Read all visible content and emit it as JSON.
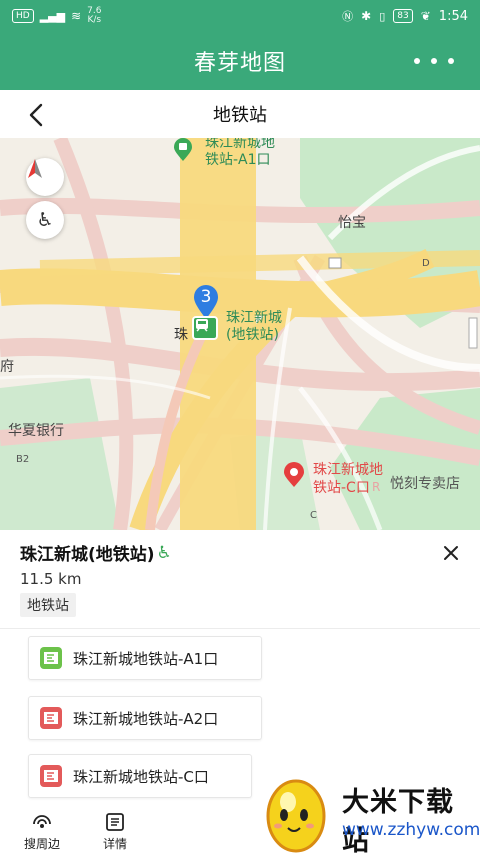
{
  "status_bar": {
    "left_icons": [
      "HD",
      "4G"
    ],
    "speed_value": "7.6",
    "speed_unit": "K/s",
    "battery": "83",
    "time": "1:54"
  },
  "app_bar": {
    "title": "春芽地图"
  },
  "nav_bar": {
    "title": "地铁站"
  },
  "map": {
    "poi_top": [
      "珠江新城地",
      "铁站-A1口"
    ],
    "poi_center": [
      "珠江新城",
      "(地铁站)"
    ],
    "poi_center_prefix": "珠",
    "poi_center_pin_number": "3",
    "label_yibao": "怡宝",
    "label_fu": "府",
    "label_huaxia": "华夏银行",
    "label_b2": "B2",
    "label_d": "D",
    "label_c": "C",
    "poi_bottom": [
      "珠江新城地",
      "铁站-C口"
    ],
    "poi_bottom_extra": "悦刻专卖店",
    "poi_bottom_faded": "R",
    "colors": {
      "road": "#f8d97e",
      "road_minor": "#f0c4c0",
      "park": "#c9e9c9",
      "water_green": "#b7e1c0"
    }
  },
  "place": {
    "name": "珠江新城(地铁站)",
    "distance": "11.5 km",
    "tag": "地铁站",
    "exits": [
      {
        "label": "珠江新城地铁站-A1口",
        "color": "#6cc24a"
      },
      {
        "label": "珠江新城地铁站-A2口",
        "color": "#e35a5a"
      },
      {
        "label": "珠江新城地铁站-C口",
        "color": "#e35a5a"
      }
    ]
  },
  "bottom_bar": {
    "nearby": "搜周边",
    "details": "详情"
  },
  "watermark": {
    "title": "大米下载站",
    "url": "www.zzhyw.com"
  }
}
